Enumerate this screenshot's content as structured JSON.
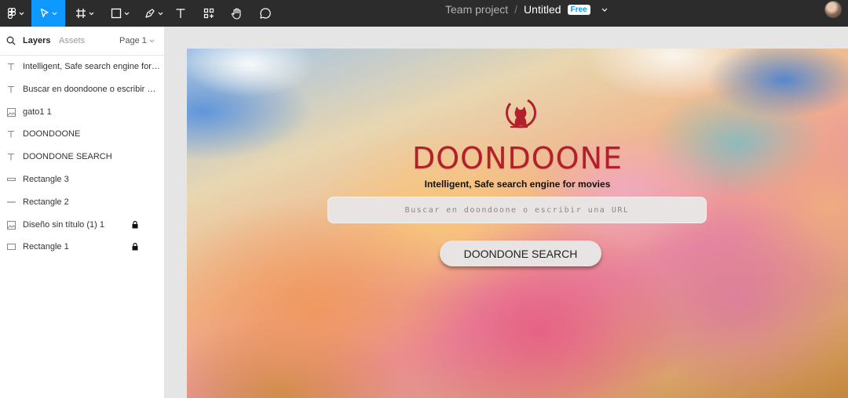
{
  "toolbar": {
    "team": "Team project",
    "separator": "/",
    "file_name": "Untitled",
    "badge": "Free"
  },
  "panel": {
    "tab_layers": "Layers",
    "tab_assets": "Assets",
    "page": "Page 1",
    "layers": [
      {
        "label": "Intelligent, Safe search engine for movies",
        "type": "text",
        "locked": false
      },
      {
        "label": "Buscar en doondoone o escribir una URL",
        "type": "text",
        "locked": false
      },
      {
        "label": "gato1 1",
        "type": "image",
        "locked": false
      },
      {
        "label": "DOONDOONE",
        "type": "text",
        "locked": false
      },
      {
        "label": "DOONDONE SEARCH",
        "type": "text",
        "locked": false
      },
      {
        "label": "Rectangle 3",
        "type": "rectangle",
        "locked": false
      },
      {
        "label": "Rectangle 2",
        "type": "line",
        "locked": false
      },
      {
        "label": "Diseño sin título (1) 1",
        "type": "image",
        "locked": true
      },
      {
        "label": "Rectangle 1",
        "type": "rectangle",
        "locked": true
      }
    ]
  },
  "design": {
    "brand": "DOONDOONE",
    "tagline": "Intelligent, Safe search engine for movies",
    "search_placeholder": "Buscar en doondoone o escribir una URL",
    "button": "DOONDONE SEARCH",
    "brand_color": "#b3202c"
  },
  "colors": {
    "accent": "#0d99ff",
    "toolbar_bg": "#2c2c2c"
  }
}
